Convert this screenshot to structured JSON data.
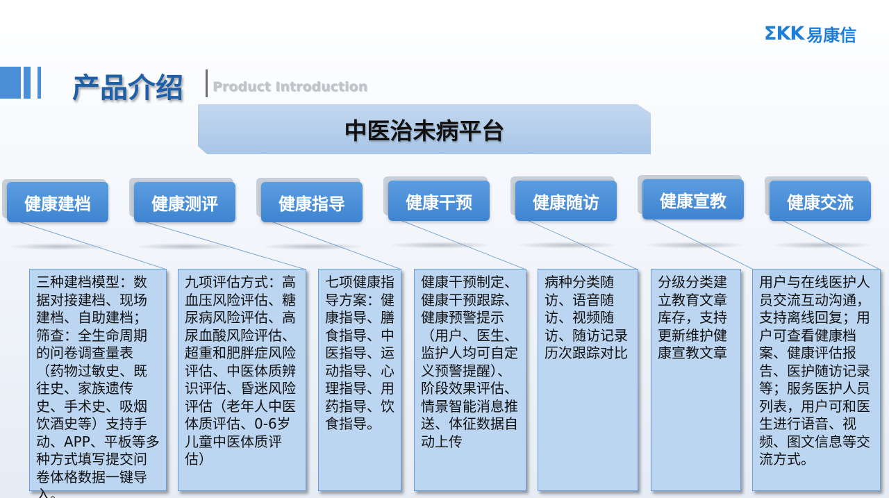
{
  "logo": {
    "mark": "ΣKK",
    "text": "易康信"
  },
  "header": {
    "title": "产品介绍",
    "subtitle": "Product Introduction"
  },
  "platform": {
    "title": "中医治未病平台"
  },
  "colors": {
    "tab": "#4a8fd8",
    "box": "#bcd6f2",
    "title": "#1e5fa8"
  },
  "modules": [
    {
      "label": "健康建档",
      "description": "三种建档模型：数据对接建档、现场建档、自助建档；筛查：全生命周期的问卷调查量表（药物过敏史、既往史、家族遗传史、手术史、吸烟饮酒史等）支持手动、APP、平板等多种方式填写提交问卷体格数据一键导入。"
    },
    {
      "label": "健康测评",
      "description": "九项评估方式：高血压风险评估、糖尿病风险评估、高尿血酸风险评估、超重和肥胖症风险评估、中医体质辨识评估、昏迷风险评估（老年人中医体质评估、0-6岁儿童中医体质评估）"
    },
    {
      "label": "健康指导",
      "description": "七项健康指导方案：健康指导、膳食指导、中医指导、运动指导、心理指导、用药指导、饮食指导。"
    },
    {
      "label": "健康干预",
      "description": "健康干预制定、健康干预跟踪、健康预警提示（用户、医生、监护人均可自定义预警提醒）、阶段效果评估、情景智能消息推送、体征数据自动上传"
    },
    {
      "label": "健康随访",
      "description": "病种分类随访、语音随访、视频随访、随访记录历次跟踪对比"
    },
    {
      "label": "健康宣教",
      "description": "分级分类建立教育文章库存，支持更新维护健康宣教文章"
    },
    {
      "label": "健康交流",
      "description": "用户与在线医护人员交流互动沟通，支持离线回复；用户可查看健康档案、健康评估报告、医护随访记录等；服务医护人员列表，用户可和医生进行语音、视频、图文信息等交流方式。"
    }
  ]
}
